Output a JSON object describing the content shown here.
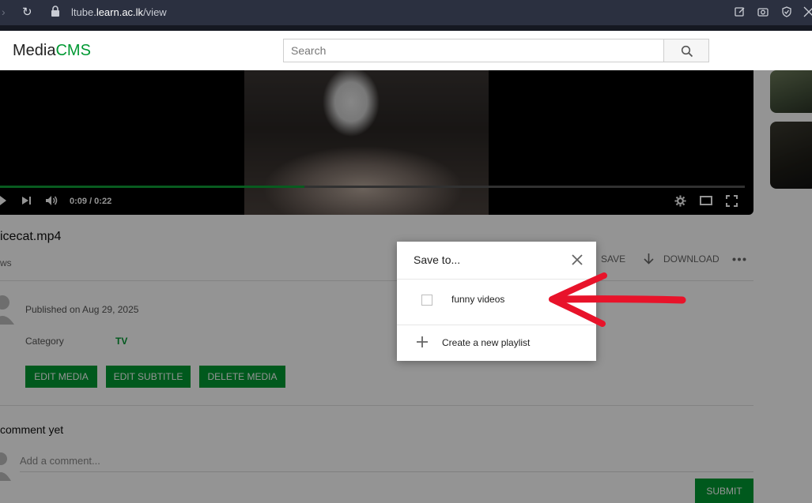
{
  "browser": {
    "url_prefix": "ltube.",
    "url_domain": "learn.ac.lk",
    "url_path": "/view"
  },
  "header": {
    "logo_main": "Media",
    "logo_accent": "CMS",
    "search_placeholder": "Search"
  },
  "player": {
    "time": "0:09 / 0:22",
    "progress_fraction": 0.409
  },
  "media": {
    "title": "icecat.mp4",
    "views": "ws",
    "save_label": "SAVE",
    "download_label": "DOWNLOAD",
    "published": "Published on Aug 29, 2025",
    "category_label": "Category",
    "category_value": "TV",
    "edit_media": "EDIT MEDIA",
    "edit_subtitle": "EDIT SUBTITLE",
    "delete_media": "DELETE MEDIA"
  },
  "comments": {
    "title": "comment yet",
    "placeholder": "Add a comment...",
    "submit": "SUBMIT"
  },
  "modal": {
    "title": "Save to...",
    "playlists": [
      {
        "name": "funny videos",
        "checked": false
      }
    ],
    "create_label": "Create a new playlist"
  },
  "colors": {
    "accent": "#009933",
    "annotation_arrow": "#e8132a"
  },
  "icons": [
    "lock-icon",
    "reload-icon",
    "search-icon",
    "close-icon",
    "plus-icon",
    "download-icon",
    "more-icon",
    "settings-icon",
    "theater-icon",
    "fullscreen-icon",
    "volume-icon",
    "next-icon",
    "play-icon"
  ]
}
